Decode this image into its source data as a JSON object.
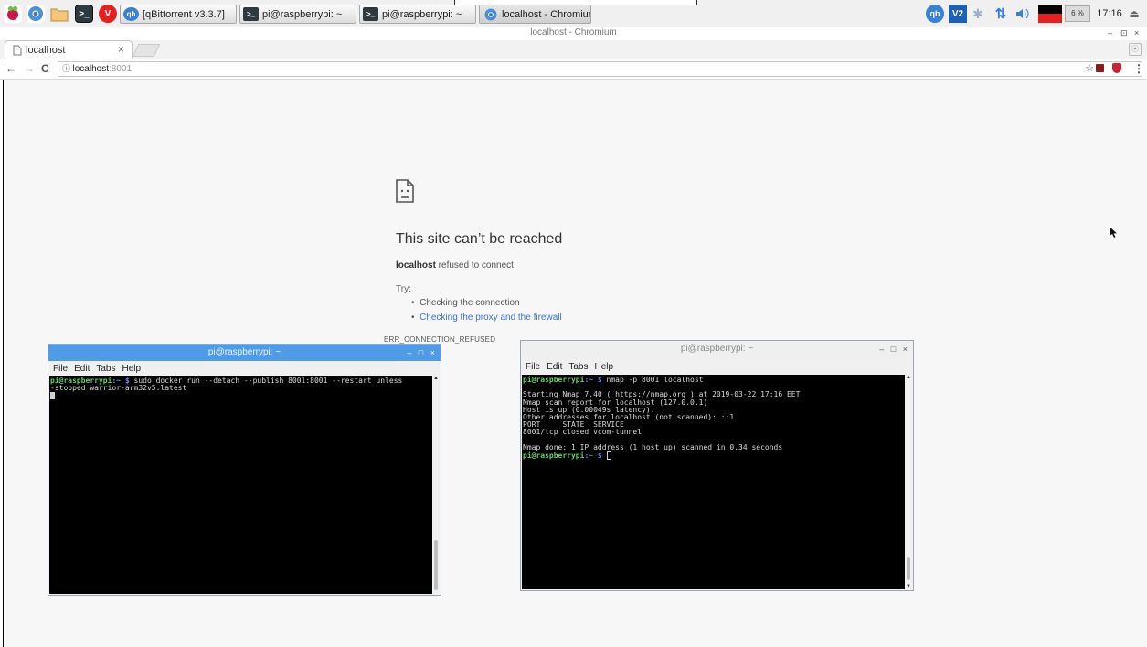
{
  "taskbar": {
    "launchers": [
      {
        "icon": "raspberry-menu-icon"
      },
      {
        "icon": "chromium-launcher-icon"
      },
      {
        "icon": "file-manager-icon"
      },
      {
        "icon": "terminal-launcher-icon",
        "glyph": ">_"
      },
      {
        "icon": "vivaldi-icon",
        "glyph": "V"
      }
    ],
    "tasks": [
      {
        "label": "[qBittorrent v3.3.7]",
        "icon": "qbittorrent-icon",
        "glyph": "qb"
      },
      {
        "label": "pi@raspberrypi: ~",
        "icon": "terminal-task-icon",
        "glyph": ">_"
      },
      {
        "label": "pi@raspberrypi: ~",
        "icon": "terminal-task-icon",
        "glyph": ">_"
      },
      {
        "label": "localhost - Chromium",
        "icon": "chromium-task-icon",
        "glyph": ""
      }
    ],
    "tray": {
      "qb_glyph": "qb",
      "vnc_glyph": "V2",
      "cpu_label": "6 %",
      "clock": "17:16"
    },
    "colors": {
      "accent": "#4f9be8",
      "red": "#e5201f"
    }
  },
  "browser": {
    "window_title": "localhost - Chromium",
    "tab_label": "localhost",
    "tab_close": "×",
    "address": "localhost",
    "address_port": ":8001",
    "window_controls": {
      "minimize": "–",
      "maximize": "⊡",
      "close": "×"
    }
  },
  "error_page": {
    "title": "This site can’t be reached",
    "host": "localhost",
    "message": " refused to connect.",
    "try_label": "Try:",
    "suggestions": [
      {
        "text": "Checking the connection",
        "link": false
      },
      {
        "text": "Checking the proxy and the firewall",
        "link": true
      }
    ],
    "error_code": "ERR_CONNECTION_REFUSED"
  },
  "terminal_left": {
    "title": "pi@raspberrypi: ~",
    "menu": [
      "File",
      "Edit",
      "Tabs",
      "Help"
    ],
    "controls": {
      "minimize": "–",
      "maximize": "□",
      "close": "×"
    },
    "prompt_user": "pi@raspberrypi",
    "prompt_path": ":~ $",
    "command": " sudo docker run --detach --publish 8001:8001 --restart unless",
    "wrap_line": "-stopped warrior-arm32v5:latest"
  },
  "terminal_right": {
    "title": "pi@raspberrypi: ~",
    "menu": [
      "File",
      "Edit",
      "Tabs",
      "Help"
    ],
    "controls": {
      "minimize": "–",
      "maximize": "□",
      "close": "×"
    },
    "prompt_user": "pi@raspberrypi",
    "prompt_path": ":~ $",
    "command": " nmap -p 8001 localhost",
    "output": [
      "",
      "Starting Nmap 7.40 ( https://nmap.org ) at 2019-03-22 17:16 EET",
      "Nmap scan report for localhost (127.0.0.1)",
      "Host is up (0.00049s latency).",
      "Other addresses for localhost (not scanned): ::1",
      "PORT     STATE  SERVICE",
      "8001/tcp closed vcom-tunnel",
      "",
      "Nmap done: 1 IP address (1 host up) scanned in 0.34 seconds"
    ]
  }
}
